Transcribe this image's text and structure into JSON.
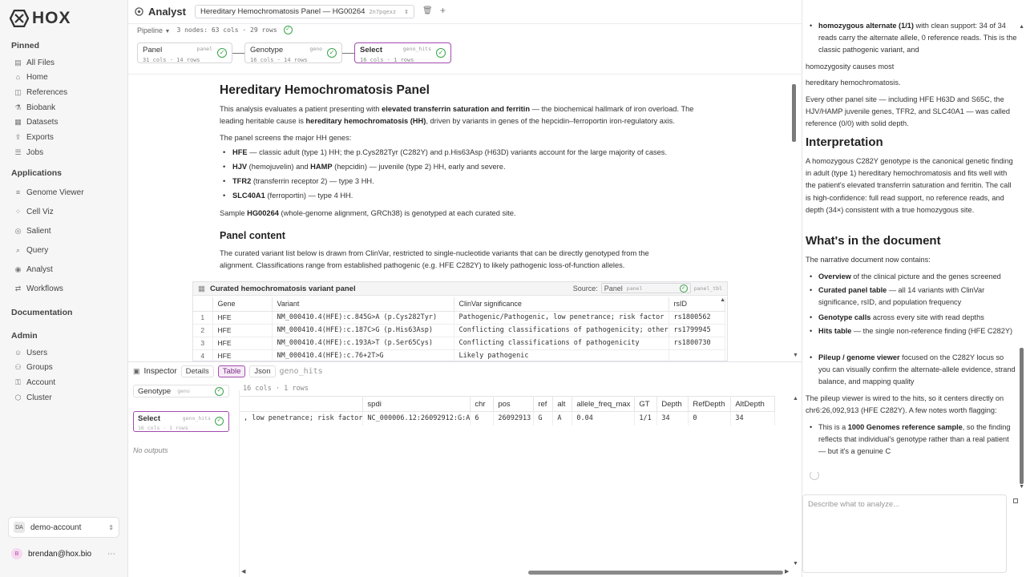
{
  "brand": {
    "logo": "HOX"
  },
  "sidebar": {
    "pinned_heading": "Pinned",
    "pinned": [
      {
        "label": "All Files",
        "icon": "files-icon"
      },
      {
        "label": "Home",
        "icon": "home-icon"
      },
      {
        "label": "References",
        "icon": "references-icon"
      },
      {
        "label": "Biobank",
        "icon": "biobank-icon"
      },
      {
        "label": "Datasets",
        "icon": "datasets-icon"
      },
      {
        "label": "Exports",
        "icon": "exports-icon"
      },
      {
        "label": "Jobs",
        "icon": "jobs-icon"
      }
    ],
    "apps_heading": "Applications",
    "apps": [
      {
        "label": "Genome Viewer",
        "icon": "genome-viewer-icon"
      },
      {
        "label": "Cell Viz",
        "icon": "cell-viz-icon"
      },
      {
        "label": "Salient",
        "icon": "salient-icon"
      },
      {
        "label": "Query",
        "icon": "query-icon"
      },
      {
        "label": "Analyst",
        "icon": "analyst-icon"
      },
      {
        "label": "Workflows",
        "icon": "workflows-icon"
      }
    ],
    "docs_heading": "Documentation",
    "admin_heading": "Admin",
    "admin": [
      {
        "label": "Users",
        "icon": "users-icon"
      },
      {
        "label": "Groups",
        "icon": "groups-icon"
      },
      {
        "label": "Account",
        "icon": "account-icon"
      },
      {
        "label": "Cluster",
        "icon": "cluster-icon"
      }
    ],
    "account": {
      "initials": "DA",
      "name": "demo-account"
    },
    "user": {
      "initial": "B",
      "email": "brendan@hox.bio"
    }
  },
  "topbar": {
    "app_title": "Analyst",
    "tab_title": "Hereditary Hemochromatosis Panel — HG00264",
    "tab_id": "2n7pqexz"
  },
  "pipeline": {
    "label": "Pipeline",
    "summary": "3 nodes: 63 cols · 29 rows",
    "nodes": [
      {
        "name": "Panel",
        "tag": "panel",
        "meta": "31 cols · 14 rows"
      },
      {
        "name": "Genotype",
        "tag": "geno",
        "meta": "16 cols · 14 rows"
      },
      {
        "name": "Select",
        "tag": "geno_hits",
        "meta": "16 cols · 1 rows"
      }
    ]
  },
  "doc": {
    "title": "Hereditary Hemochromatosis Panel",
    "intro_a": "This analysis evaluates a patient presenting with ",
    "intro_b": "elevated transferrin saturation and ferritin",
    "intro_c": " — the biochemical hallmark of iron overload. The leading heritable cause is ",
    "intro_d": "hereditary hemochromatosis (HH)",
    "intro_e": ", driven by variants in genes of the hepcidin–ferroportin iron-regulatory axis.",
    "screens": "The panel screens the major HH genes:",
    "genes": [
      {
        "b1": "HFE",
        "t1": " — classic adult (type 1) HH; the p.Cys282Tyr (C282Y) and p.His63Asp (H63D) variants account for the large majority of cases.",
        "b2": "",
        "t2": ""
      },
      {
        "b1": "HJV",
        "t1": " (hemojuvelin) and ",
        "b2": "HAMP",
        "t2": " (hepcidin) — juvenile (type 2) HH, early and severe."
      },
      {
        "b1": "TFR2",
        "t1": " (transferrin receptor 2) — type 3 HH.",
        "b2": "",
        "t2": ""
      },
      {
        "b1": "SLC40A1",
        "t1": " (ferroportin) — type 4 HH.",
        "b2": "",
        "t2": ""
      }
    ],
    "sample_a": "Sample ",
    "sample_b": "HG00264",
    "sample_c": " (whole-genome alignment, GRCh38) is genotyped at each curated site.",
    "panel_heading": "Panel content",
    "panel_text": "The curated variant list below is drawn from ClinVar, restricted to single-nucleotide variants that can be directly genotyped from the alignment. Classifications range from established pathogenic (e.g. HFE C282Y) to likely pathogenic loss-of-function alleles."
  },
  "variant_table": {
    "title": "Curated hemochromatosis variant panel",
    "source_label": "Source:",
    "source_value": "Panel",
    "source_tag": "panel",
    "table_id": "panel_tbl",
    "columns": [
      "",
      "Gene",
      "Variant",
      "ClinVar significance",
      "rsID"
    ],
    "rows": [
      [
        "1",
        "HFE",
        "NM_000410.4(HFE):c.845G>A (p.Cys282Tyr)",
        "Pathogenic/Pathogenic, low penetrance; risk factor",
        "rs1800562"
      ],
      [
        "2",
        "HFE",
        "NM_000410.4(HFE):c.187C>G (p.His63Asp)",
        "Conflicting classifications of pathogenicity; other",
        "rs1799945"
      ],
      [
        "3",
        "HFE",
        "NM_000410.4(HFE):c.193A>T (p.Ser65Cys)",
        "Conflicting classifications of pathogenicity",
        "rs1800730"
      ],
      [
        "4",
        "HFE",
        "NM_000410.4(HFE):c.76+2T>G",
        "Likely pathogenic",
        ""
      ]
    ]
  },
  "inspector": {
    "label": "Inspector",
    "tabs": [
      "Details",
      "Table",
      "Json"
    ],
    "active_tab": "Table",
    "node": "geno_hits",
    "upstream": {
      "name": "Genotype",
      "tag": "geno"
    },
    "selected": {
      "name": "Select",
      "tag": "geno_hits",
      "meta": "16 cols · 1 rows"
    },
    "no_outputs": "No outputs",
    "summary": "16 cols · 1 rows",
    "columns": [
      "",
      "spdi",
      "chr",
      "pos",
      "ref",
      "alt",
      "allele_freq_max",
      "GT",
      "Depth",
      "RefDepth",
      "AltDepth"
    ],
    "rows": [
      [
        ", low penetrance; risk factor",
        "NC_000006.12:26092912:G:A",
        "6",
        "26092913",
        "G",
        "A",
        "0.04",
        "1/1",
        "34",
        "0",
        "34"
      ]
    ]
  },
  "chat": {
    "p1_b": "homozygous alternate (1/1)",
    "p1_t": " with clean support: 34 of 34 reads carry the alternate allele, 0 reference reads. This is the classic pathogenic variant, and",
    "p2": "homozygosity causes most",
    "p3": "hereditary hemochromatosis.",
    "p4": "Every other panel site — including HFE H63D and S65C, the HJV/HAMP juvenile genes, TFR2, and SLC40A1 — was called reference (0/0) with solid depth.",
    "h_interp": "Interpretation",
    "interp": "A homozygous C282Y genotype is the canonical genetic finding in adult (type 1) hereditary hemochromatosis and fits well with the patient's elevated transferrin saturation and ferritin. The call is high-confidence: full read support, no reference reads, and depth (34×) consistent with a true homozygous site.",
    "h_doc": "What's in the document",
    "doc_intro": "The narrative document now contains:",
    "items": [
      {
        "b": "Overview",
        "t": " of the clinical picture and the genes screened"
      },
      {
        "b": "Curated panel table",
        "t": " — all 14 variants with ClinVar significance, rsID, and population frequency"
      },
      {
        "b": "Genotype calls",
        "t": " across every site with read depths"
      },
      {
        "b": "Hits table",
        "t": " — the single non-reference finding (HFE C282Y)"
      },
      {
        "b": "Pileup / genome viewer",
        "t": " focused on the C282Y locus so you can visually confirm the alternate-allele evidence, strand balance, and mapping quality"
      }
    ],
    "pileup": "The pileup viewer is wired to the hits, so it centers directly on chr6:26,092,913 (HFE C282Y). A few notes worth flagging:",
    "note_a": "This is a ",
    "note_b": "1000 Genomes reference sample",
    "note_c": ", so the finding reflects that individual's genotype rather than a real patient — but it's a genuine C",
    "input_placeholder": "Describe what to analyze..."
  }
}
